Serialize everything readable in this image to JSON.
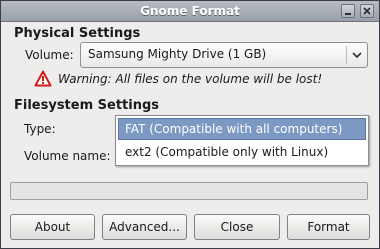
{
  "window": {
    "title": "Gnome Format"
  },
  "physical": {
    "heading": "Physical Settings",
    "volume_label": "Volume:",
    "volume_value": "Samsung Mighty Drive (1 GB)",
    "warning": "Warning: All files on the volume will be lost!"
  },
  "filesystem": {
    "heading": "Filesystem Settings",
    "type_label": "Type:",
    "volume_name_label": "Volume name:",
    "type_options": [
      "FAT (Compatible with all computers)",
      "ext2 (Compatible only with Linux)"
    ],
    "selected_option_index": 0
  },
  "progress": {
    "value": 0
  },
  "buttons": {
    "about": "About",
    "advanced": "Advanced...",
    "close": "Close",
    "format": "Format"
  },
  "icons": {
    "titlebar_minimize": "minimize-icon",
    "titlebar_close": "close-icon",
    "warning": "warning-icon",
    "combo_arrow": "chevron-down-icon"
  },
  "colors": {
    "selection": "#7c99c3",
    "warning_icon": "#d01c1c",
    "titlebar": "#a8adb5"
  }
}
